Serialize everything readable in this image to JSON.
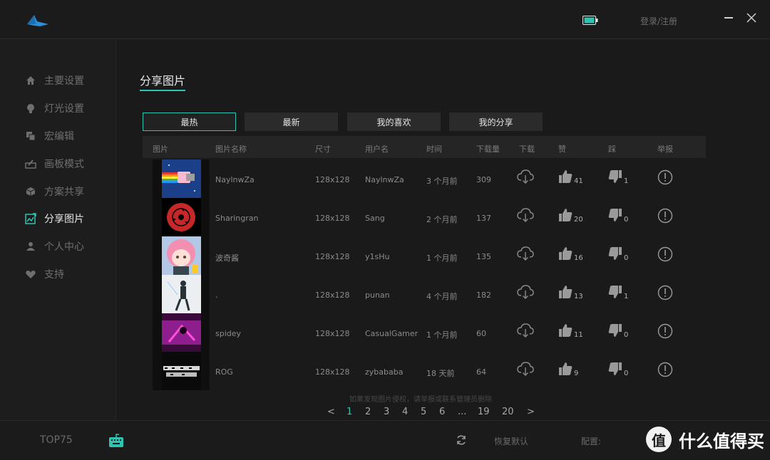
{
  "titlebar": {
    "login_label": "登录/注册",
    "icons": [
      "shark-logo-icon",
      "battery-icon",
      "minimize-icon",
      "close-icon"
    ]
  },
  "sidebar": {
    "items": [
      {
        "label": "主要设置",
        "icon": "home-icon"
      },
      {
        "label": "灯光设置",
        "icon": "bulb-icon"
      },
      {
        "label": "宏编辑",
        "icon": "macro-icon"
      },
      {
        "label": "画板模式",
        "icon": "drawing-board-icon"
      },
      {
        "label": "方案共享",
        "icon": "cube-icon"
      },
      {
        "label": "分享图片",
        "icon": "image-share-icon",
        "active": true
      },
      {
        "label": "个人中心",
        "icon": "user-icon"
      },
      {
        "label": "支持",
        "icon": "heart-icon"
      }
    ]
  },
  "main": {
    "title": "分享图片",
    "tabs": [
      {
        "label": "最热",
        "active": true
      },
      {
        "label": "最新"
      },
      {
        "label": "我的喜欢"
      },
      {
        "label": "我的分享"
      }
    ],
    "columns": [
      "图片",
      "图片名称",
      "尺寸",
      "用户名",
      "时间",
      "下载量",
      "下载",
      "赞",
      "踩",
      "举报"
    ],
    "rows": [
      {
        "name": "NaylnwZa",
        "size": "128x128",
        "user": "NaylnwZa",
        "time": "3 个月前",
        "downloads": "309",
        "likes": "41",
        "dislikes": "1",
        "thumb": "nyan-cat"
      },
      {
        "name": "Sharingran",
        "size": "128x128",
        "user": "Sang",
        "time": "2 个月前",
        "downloads": "137",
        "likes": "20",
        "dislikes": "0",
        "thumb": "sharingan"
      },
      {
        "name": "波奇酱",
        "size": "128x128",
        "user": "y1sHu",
        "time": "1 个月前",
        "downloads": "135",
        "likes": "16",
        "dislikes": "0",
        "thumb": "pink-hair-girl"
      },
      {
        "name": ".",
        "size": "128x128",
        "user": "punan",
        "time": "4 个月前",
        "downloads": "182",
        "likes": "13",
        "dislikes": "1",
        "thumb": "standing-figure"
      },
      {
        "name": "spidey",
        "size": "128x128",
        "user": "CasualGamer",
        "time": "1 个月前",
        "downloads": "60",
        "likes": "11",
        "dislikes": "0",
        "thumb": "neon-spider"
      },
      {
        "name": "ROG",
        "size": "128x128",
        "user": "zybababa",
        "time": "18 天前",
        "downloads": "64",
        "likes": "9",
        "dislikes": "0",
        "thumb": "rog-text"
      }
    ],
    "notice": "如果发现图片侵权，请举报或联系管理员删除",
    "pagination": {
      "prev": "<",
      "pages": [
        "1",
        "2",
        "3",
        "4",
        "5",
        "6",
        "...",
        "19",
        "20"
      ],
      "current": "1",
      "next": ">"
    }
  },
  "bottombar": {
    "device_label": "TOP75",
    "reset_label": "恢复默认",
    "config_label": "配置:"
  },
  "watermark": {
    "badge": "值",
    "text": "什么值得买"
  },
  "colors": {
    "accent": "#2fc4b2",
    "background": "#1a1a1a",
    "panel": "#252525"
  }
}
